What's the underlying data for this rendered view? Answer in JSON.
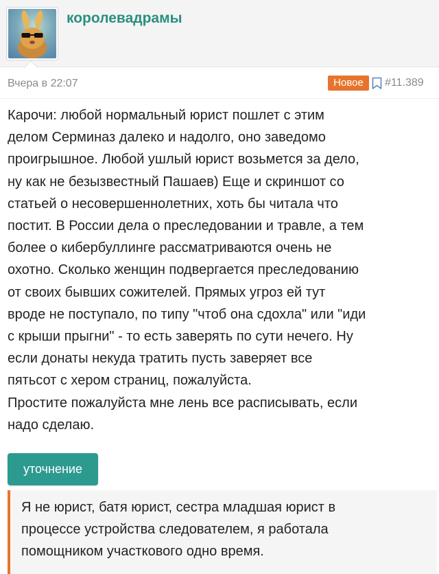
{
  "post": {
    "author": "королевадрамы",
    "timestamp": "Вчера в 22:07",
    "badge": "Новое",
    "number": "#11.389",
    "body": "Карочи: любой нормальный юрист пошлет с этим\nделом Серминаз далеко и надолго, оно заведомо\nпроигрышное. Любой ушлый юрист возьмется за дело,\nну как не безызвестный Пашаев) Еще и скриншот со\nстатьей о несовершеннолетних, хоть бы читала что\nпостит. В России дела о преследовании и травле, а тем\nболее о кибербуллинге рассматриваются очень не\nохотно. Сколько женщин подвергается преследованию\nот своих бывших сожителей. Прямых угроз ей тут\nвроде не поступало, по типу \"чтоб она сдохла\" или \"иди\nс крыши прыгни\" - то есть заверять по сути нечего. Ну\nесли донаты некуда тратить пусть заверяет все\nпятьсот с хером страниц, пожалуйста.\nПростите пожалуйста мне лень все расписывать, если\nнадо сделаю.",
    "spoiler_button_label": "уточнение",
    "spoiler_text": "Я не юрист, батя юрист, сестра младшая юрист в\nпроцессе устройства следователем, я работала\nпомощником участкового одно время."
  },
  "icons": {
    "avatar": "avatar-image",
    "bookmark": "bookmark-icon"
  },
  "colors": {
    "accent": "#2a8f80",
    "button": "#2d9a8f",
    "badge": "#e7742c",
    "meta_text": "#8a8a8a",
    "header_bg": "#f4f4f4"
  }
}
